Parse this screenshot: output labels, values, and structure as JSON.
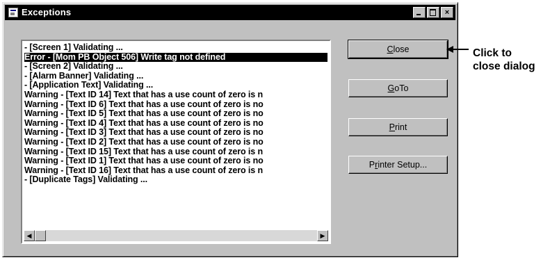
{
  "window": {
    "title": "Exceptions",
    "controls": {
      "minimize": "minimize",
      "maximize": "maximize",
      "close": "×"
    }
  },
  "list": {
    "items": [
      "- [Screen 1] Validating ...",
      "Error - [Mom PB Object 506] Write tag not defined",
      "- [Screen 2] Validating ...",
      "- [Alarm Banner] Validating ...",
      "- [Application Text] Validating ...",
      "Warning - [Text ID 14] Text that has a use count of zero is n",
      "Warning - [Text ID 6] Text that has a use count of zero is no",
      "Warning - [Text ID 5] Text that has a use count of zero is no",
      "Warning - [Text ID 4] Text that has a use count of zero is no",
      "Warning - [Text ID 3] Text that has a use count of zero is no",
      "Warning - [Text ID 2] Text that has a use count of zero is no",
      "Warning - [Text ID 15] Text that has a use count of zero is n",
      "Warning - [Text ID 1] Text that has a use count of zero is no",
      "Warning - [Text ID 16] Text that has a use count of zero is n",
      "- [Duplicate Tags] Validating ..."
    ],
    "selected_index": 1,
    "scroll_left_icon": "◀",
    "scroll_right_icon": "▶"
  },
  "buttons": {
    "close": {
      "accel": "C",
      "rest": "lose"
    },
    "goto": {
      "accel": "G",
      "rest": "oTo"
    },
    "print": {
      "accel": "P",
      "rest": "rint"
    },
    "printer_setup": {
      "pre": "P",
      "accel": "r",
      "rest": "inter Setup..."
    }
  },
  "annotation": {
    "line1": "Click to",
    "line2": "close dialog"
  }
}
